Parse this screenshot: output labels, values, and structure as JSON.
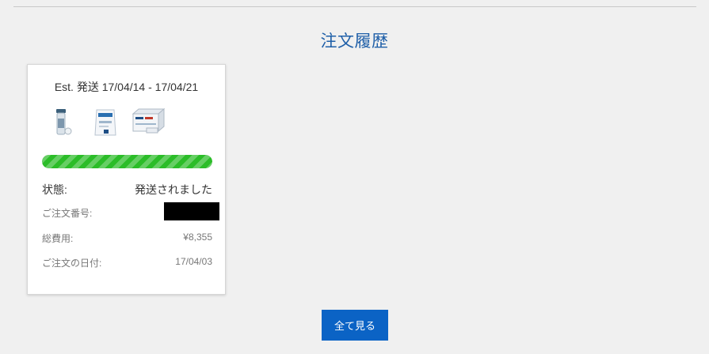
{
  "page": {
    "title": "注文履歴"
  },
  "order": {
    "estimated_shipping": "Est. 発送 17/04/14 - 17/04/21",
    "product_icons": [
      "shaker-bottle-icon",
      "protein-pouch-icon",
      "bar-box-pack-icon"
    ],
    "progress_percent": 100,
    "progress_color": "#2bbd28",
    "status_label": "状態:",
    "status_value": "発送されました",
    "order_number_label": "ご注文番号:",
    "total_label": "総費用:",
    "total_value": "¥8,355",
    "order_date_label": "ご注文の日付:",
    "order_date_value": "17/04/03"
  },
  "actions": {
    "view_all_label": "全て見る"
  },
  "colors": {
    "title": "#1f5fa8",
    "button": "#0b63c5",
    "background": "#f0f0f0"
  }
}
